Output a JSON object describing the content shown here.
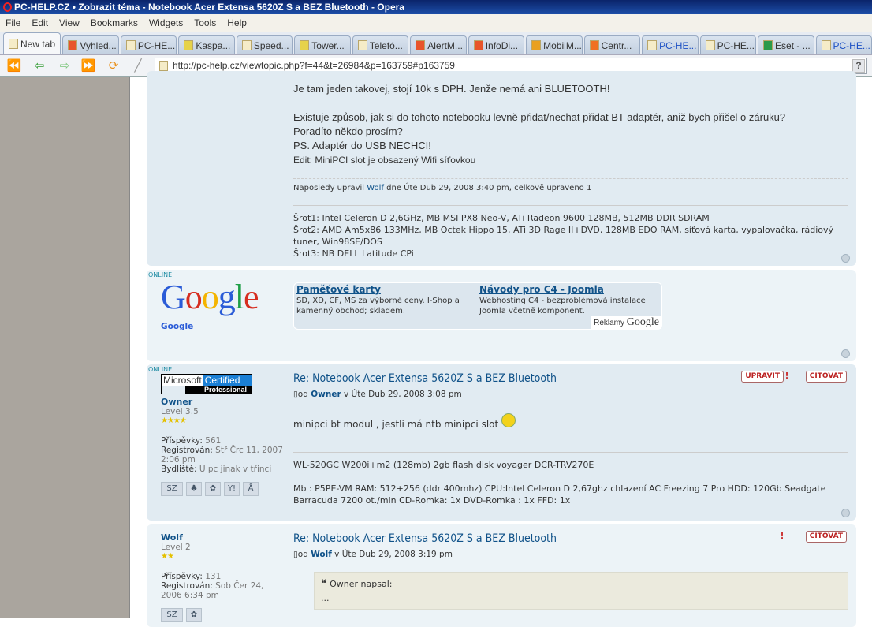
{
  "window": {
    "title": "PC-HELP.CZ • Zobrazit téma - Notebook Acer Extensa 5620Z S a BEZ Bluetooth - Opera"
  },
  "menu": [
    "File",
    "Edit",
    "View",
    "Bookmarks",
    "Widgets",
    "Tools",
    "Help"
  ],
  "tabs": [
    "New tab",
    "Vyhled...",
    "PC-HE...",
    "Kaspa...",
    "Speed...",
    "Tower...",
    "Telefó...",
    "AlertM...",
    "InfoDi...",
    "MobilM...",
    "Centr...",
    "PC-HE...",
    "PC-HE...",
    "Eset - ...",
    "PC-HE..."
  ],
  "address": {
    "url": "http://pc-help.cz/viewtopic.php?f=44&t=26984&p=163759#p163759",
    "help": "?"
  },
  "post1": {
    "lines": [
      "Je tam jeden takovej, stojí 10k s DPH. Jenže nemá ani BLUETOOTH!",
      "Existuje způsob, jak si do tohoto notebooku levně přidat/nechat přidat BT adaptér, aniž bych přišel o záruku?",
      "Poradíto někdo prosím?",
      "PS. Adaptér do USB NECHCI!"
    ],
    "edit": "Edit: MiniPCI slot je obsazený Wifi síťovkou",
    "edited_prefix": "Naposledy upravil",
    "edited_by": "Wolf",
    "edited_suffix": "dne Úte Dub 29, 2008 3:40 pm, celkově upraveno 1",
    "sig": [
      "Šrot1: Intel Celeron D 2,6GHz, MB MSI PX8 Neo-V, ATi Radeon 9600 128MB, 512MB DDR SDRAM",
      "Šrot2: AMD Am5x86 133MHz, MB Octek Hippo 15, ATi 3D Rage II+DVD, 128MB EDO RAM, síťová karta, vypalovačka, rádiový tuner, Win98SE/DOS",
      "Šrot3: NB DELL Latitude CPi"
    ]
  },
  "ad": {
    "online": "ONLINE",
    "logo": "Google",
    "name": "Google",
    "items": [
      {
        "title": "Paměťové karty",
        "text": "SD, XD, CF, MS za výborné ceny. I-Shop a kamenný obchod; skladem."
      },
      {
        "title": "Návody pro C4 - Joomla",
        "text": "Webhosting C4 - bezproblémová instalace Joomla včetně komponent."
      }
    ],
    "reklamy": "Reklamy",
    "reklamy_logo": "Google"
  },
  "post2": {
    "online": "ONLINE",
    "badge1": "Microsoft",
    "badge2": "Certified",
    "badge3": "Professional",
    "user": "Owner",
    "level": "Level 3.5",
    "stars": "★★★★",
    "posts_label": "Příspěvky:",
    "posts": "561",
    "reg_label": "Registrován:",
    "reg": "Stř Črc 11, 2007 2:06 pm",
    "loc_label": "Bydliště:",
    "loc": "U pc jinak v třinci",
    "title": "Re: Notebook Acer Extensa 5620Z S a BEZ Bluetooth",
    "by": "od",
    "author": "Owner",
    "date": "v Úte Dub 29, 2008 3:08 pm",
    "text": "minipci bt modul , jestli má ntb minipci slot",
    "edit_btn": "UPRAVIT",
    "quote_btn": "CITOVAT",
    "report": "!",
    "pm": "SZ",
    "sig1": "WL-520GC W200i+m2 (128mb) 2gb flash disk voyager DCR-TRV270E",
    "sig2": "Mb : P5PE-VM RAM: 512+256 (ddr 400mhz) CPU:Intel Celeron D 2,67ghz chlazení AC Freezing 7 Pro HDD: 120Gb Seadgate Barracuda 7200 ot./min CD-Romka: 1x DVD-Romka : 1x FFD: 1x"
  },
  "post3": {
    "user": "Wolf",
    "level": "Level 2",
    "stars": "★★",
    "posts_label": "Příspěvky:",
    "posts": "131",
    "reg_label": "Registrován:",
    "reg": "Sob Čer 24, 2006 6:34 pm",
    "title": "Re: Notebook Acer Extensa 5620Z S a BEZ Bluetooth",
    "by": "od",
    "author": "Wolf",
    "date": "v Úte Dub 29, 2008 3:19 pm",
    "quote_btn": "CITOVAT",
    "report": "!",
    "quote_author": "Owner napsal:",
    "quote_text": "...",
    "pm": "SZ"
  }
}
